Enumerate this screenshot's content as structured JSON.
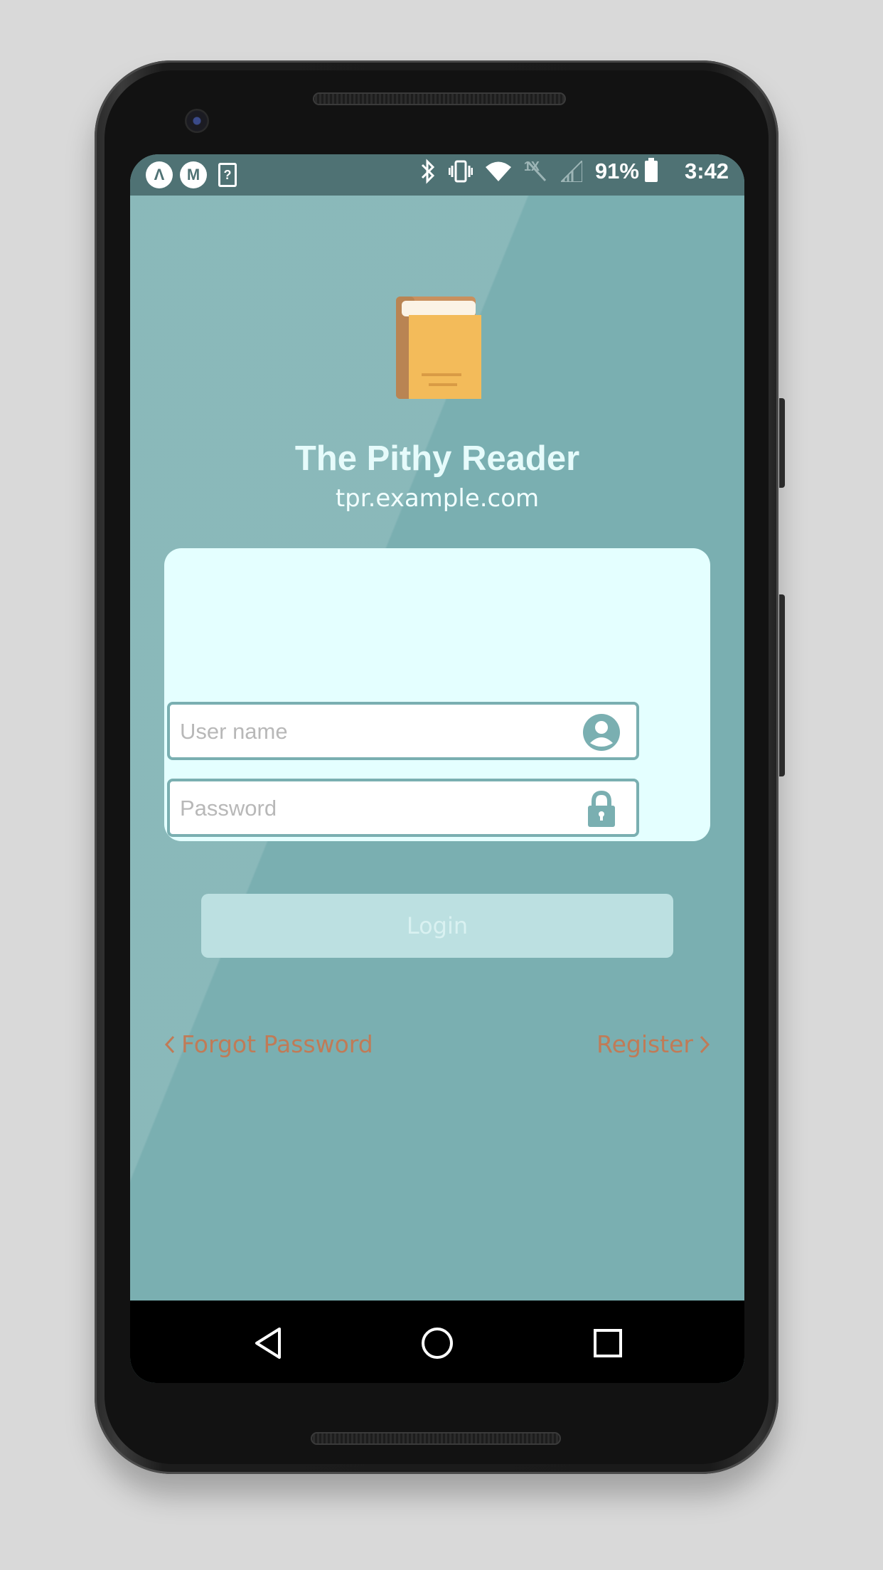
{
  "status_bar": {
    "left_icons": [
      "a-icon",
      "m-icon",
      "sim-unknown-icon"
    ],
    "left_glyphs": {
      "a": "Λ",
      "m": "M",
      "doc": "?"
    },
    "right_icons": [
      "bluetooth-icon",
      "vibrate-icon",
      "wifi-icon",
      "data-off-icon",
      "signal-icon",
      "battery-icon"
    ],
    "data_label": "1X",
    "battery_percent": "91%",
    "time": "3:42"
  },
  "app": {
    "logo_icon": "book-icon",
    "title": "The Pithy Reader",
    "subtitle": "tpr.example.com"
  },
  "form": {
    "username_placeholder": "User name",
    "username_value": "",
    "username_icon": "user-icon",
    "password_placeholder": "Password",
    "password_value": "",
    "password_icon": "lock-icon",
    "login_label": "Login"
  },
  "links": {
    "forgot_label": "Forgot Password",
    "register_label": "Register"
  },
  "nav_bar": {
    "icons": [
      "back-icon",
      "home-icon",
      "recents-icon"
    ]
  },
  "colors": {
    "background": "#7aafb1",
    "card": "#e4ffff",
    "status_bar": "#4f7274",
    "link": "#c07b57",
    "login_button": "#bce0e1",
    "title_text": "#e6fbfb"
  }
}
